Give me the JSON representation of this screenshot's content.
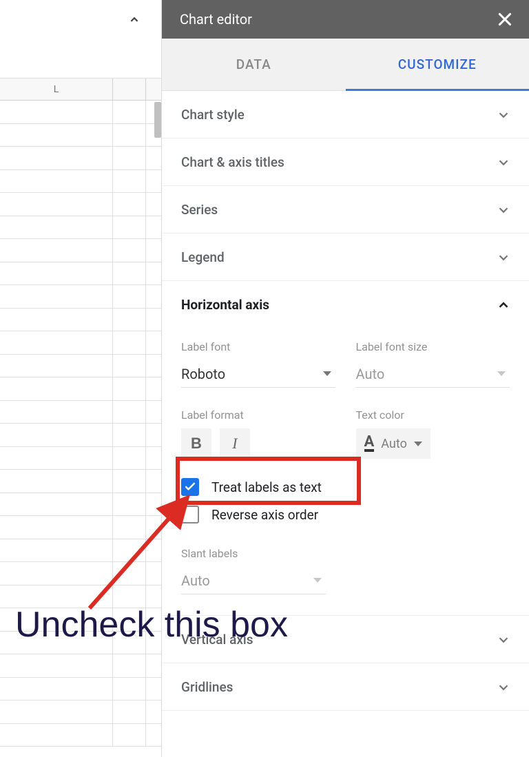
{
  "editor": {
    "title": "Chart editor",
    "tabs": {
      "data": "DATA",
      "customize": "CUSTOMIZE"
    }
  },
  "sheet": {
    "column_header": "L",
    "num_rows": 28
  },
  "sections": {
    "chart_style": "Chart style",
    "chart_axis_titles": "Chart & axis titles",
    "series": "Series",
    "legend": "Legend",
    "horizontal_axis": "Horizontal axis",
    "vertical_axis": "Vertical axis",
    "gridlines": "Gridlines"
  },
  "haxis": {
    "label_font": "Label font",
    "label_font_value": "Roboto",
    "label_font_size": "Label font size",
    "label_font_size_value": "Auto",
    "label_format": "Label format",
    "text_color": "Text color",
    "text_color_value": "Auto",
    "treat_labels_as_text": "Treat labels as text",
    "reverse_axis_order": "Reverse axis order",
    "slant_labels": "Slant labels",
    "slant_labels_value": "Auto"
  },
  "annotation": {
    "text": "Uncheck this box"
  }
}
